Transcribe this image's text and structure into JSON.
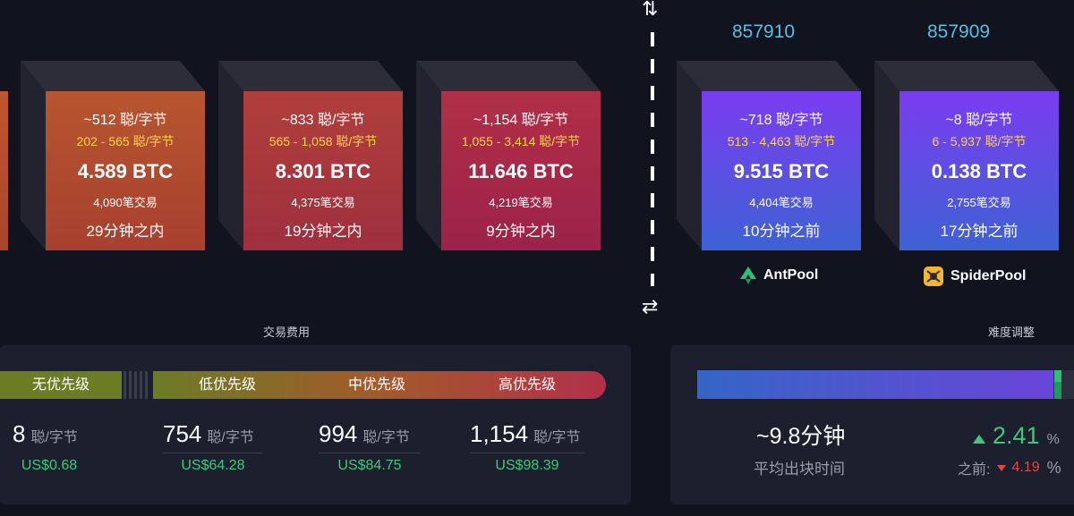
{
  "mempool_blocks": [
    {
      "fee": "~512 聪/字节",
      "range": "202 - 565 聪/字节",
      "btc": "4.589 BTC",
      "tx": "4,090笔交易",
      "time": "29分钟之内"
    },
    {
      "fee": "~833 聪/字节",
      "range": "565 - 1,058 聪/字节",
      "btc": "8.301 BTC",
      "tx": "4,375笔交易",
      "time": "19分钟之内"
    },
    {
      "fee": "~1,154 聪/字节",
      "range": "1,055 - 3,414 聪/字节",
      "btc": "11.646 BTC",
      "tx": "4,219笔交易",
      "time": "9分钟之内"
    }
  ],
  "mined_blocks": [
    {
      "height": "857910",
      "fee": "~718 聪/字节",
      "range": "513 - 4,463 聪/字节",
      "btc": "9.515 BTC",
      "tx": "4,404笔交易",
      "time": "10分钟之前",
      "pool": "AntPool"
    },
    {
      "height": "857909",
      "fee": "~8 聪/字节",
      "range": "6 - 5,937 聪/字节",
      "btc": "0.138 BTC",
      "tx": "2,755笔交易",
      "time": "17分钟之前",
      "pool": "SpiderPool"
    }
  ],
  "divider": {
    "top_icon": "⇅",
    "bottom_icon": "⇄"
  },
  "fees": {
    "title": "交易费用",
    "priorities": [
      "无优先级",
      "低优先级",
      "中优先级",
      "高优先级"
    ],
    "items": [
      {
        "value": "8",
        "unit": "聪/字节",
        "usd": "US$0.68"
      },
      {
        "value": "754",
        "unit": "聪/字节",
        "usd": "US$64.28"
      },
      {
        "value": "994",
        "unit": "聪/字节",
        "usd": "US$84.75"
      },
      {
        "value": "1,154",
        "unit": "聪/字节",
        "usd": "US$98.39"
      }
    ]
  },
  "difficulty": {
    "title": "难度调整",
    "avg_time": "~9.8分钟",
    "avg_label": "平均出块时间",
    "change": "2.41",
    "change_unit": "%",
    "prev_label": "之前:",
    "prev_change": "4.19",
    "prev_unit": "%",
    "progress": 0.975
  },
  "colors": {
    "height": "#5bbde4",
    "range": "#ffd54a",
    "usd": "#3ec97a",
    "up": "#3ec97a",
    "down": "#e04848"
  }
}
